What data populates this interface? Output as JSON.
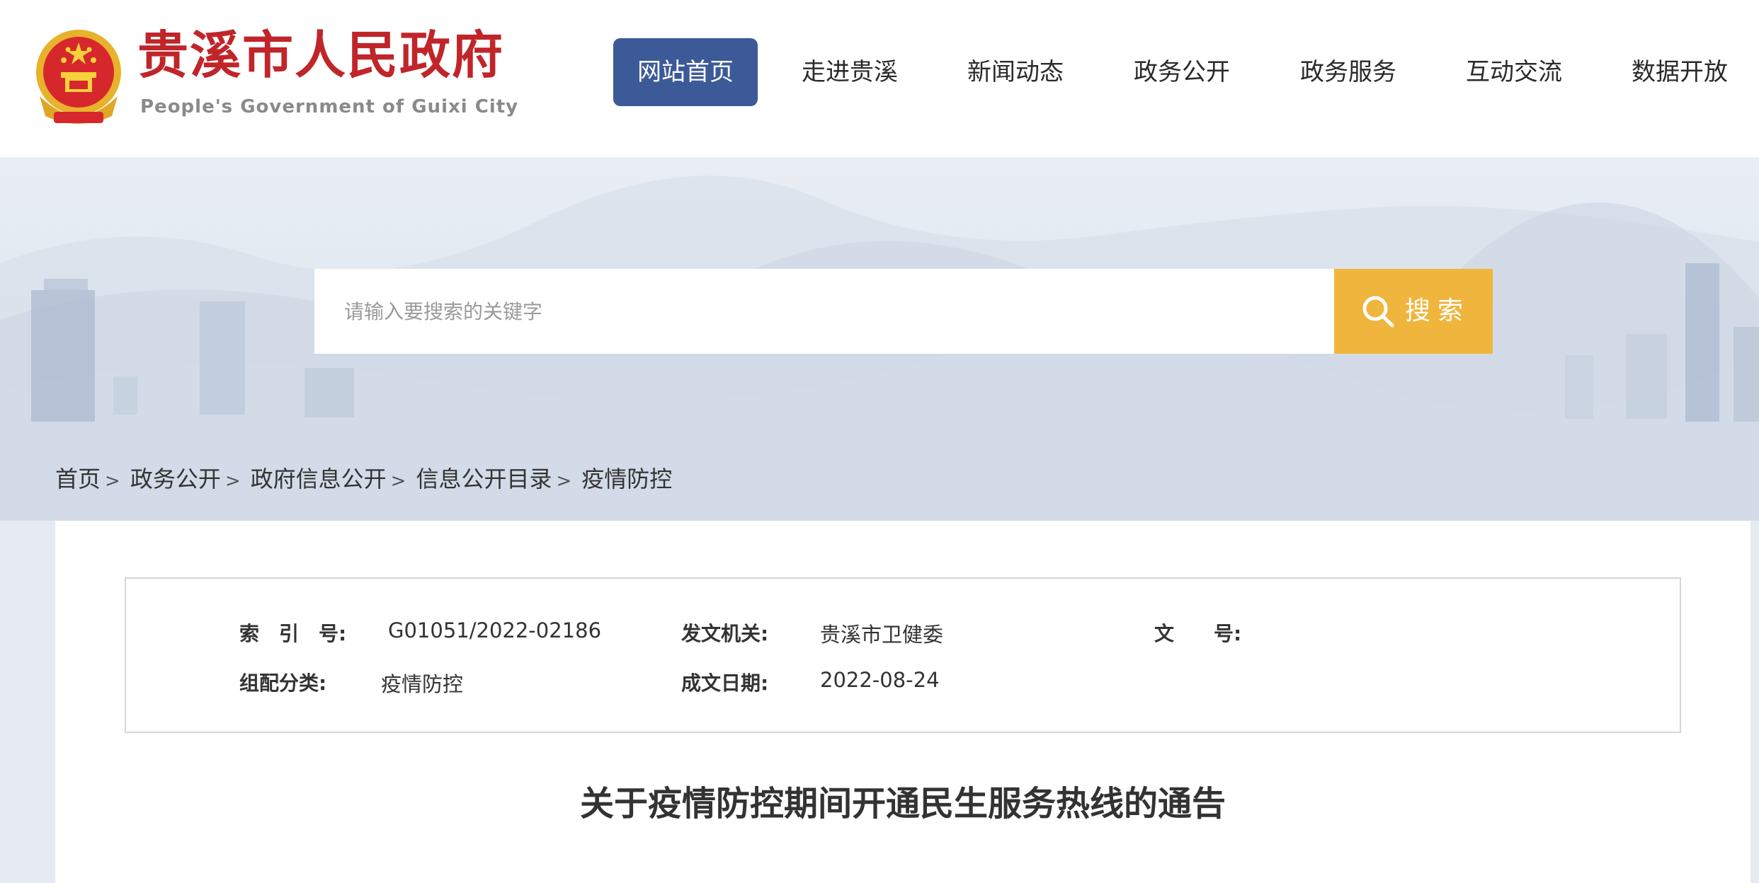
{
  "header": {
    "title": "贵溪市人民政府",
    "subtitle": "People's Government of Guixi City",
    "emblem_icon": "national-emblem-icon",
    "brand_color": "#c0252a"
  },
  "nav": {
    "active_color": "#3c5a97",
    "items": [
      {
        "label": "网站首页"
      },
      {
        "label": "走进贵溪"
      },
      {
        "label": "新闻动态"
      },
      {
        "label": "政务公开"
      },
      {
        "label": "政务服务"
      },
      {
        "label": "互动交流"
      },
      {
        "label": "数据开放"
      }
    ]
  },
  "search": {
    "placeholder": "请输入要搜索的关键字",
    "button_label": "搜索",
    "button_icon": "search-icon",
    "button_color": "#f0b53d"
  },
  "breadcrumb": {
    "separator": ">",
    "items": [
      "首页",
      "政务公开",
      "政府信息公开",
      "信息公开目录",
      "疫情防控"
    ]
  },
  "meta": {
    "index_label": "索　引　号:",
    "index_value": "G01051/2022-02186",
    "issuer_label": "发文机关:",
    "issuer_value": "贵溪市卫健委",
    "docno_label": "文　　号:",
    "docno_value": "",
    "category_label": "组配分类:",
    "category_value": "疫情防控",
    "date_label": "成文日期:",
    "date_value": "2022-08-24"
  },
  "document": {
    "title": "关于疫情防控期间开通民生服务热线的通告"
  }
}
